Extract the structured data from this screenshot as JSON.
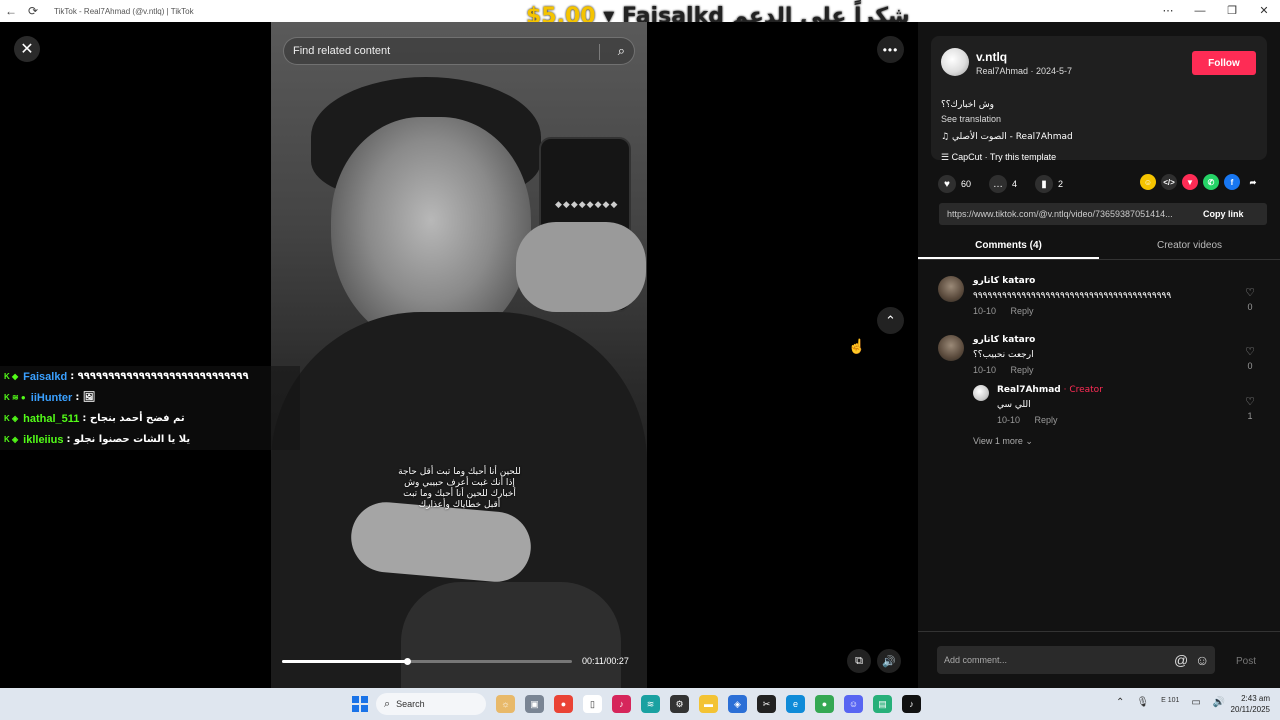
{
  "browser": {
    "title": "TikTok - Real7Ahmad (@v.ntlq) | TikTok",
    "back_icon": "←",
    "reload_icon": "⟳",
    "menu_icon": "⋯",
    "minimize_icon": "—",
    "restore_icon": "❐",
    "close_icon": "✕"
  },
  "donation": {
    "amount": "$5.00",
    "name": "Faisalkd",
    "rest": "شكراً على الدعم"
  },
  "player": {
    "close_label": "✕",
    "search_placeholder": "Find related content",
    "more_label": "•••",
    "up_label": "⌃",
    "caption": "للحين أنا أحبك وما تبت أقل حاجة إذا أنك غبت أعرف حبيبي وش أخبارك للحين أنا أحبك وما تبت أقبل خطاياك وأعذارك",
    "progress": 0.43,
    "time": "00:11/00:27",
    "phone_dots": "◆◆◆◆◆◆◆◆"
  },
  "chat": [
    {
      "badges": "K ◆",
      "name": "Faisalkd",
      "color": "#3aa0ff",
      "text": "٩٩٩٩٩٩٩٩٩٩٩٩٩٩٩٩٩٩٩٩٩٩٩٩٩٩٩٩"
    },
    {
      "badges": "K ≋ ●",
      "name": "iiHunter",
      "color": "#3aa0ff",
      "text": "🖼"
    },
    {
      "badges": "K ◈",
      "name": "hathal_511",
      "color": "#53fc18",
      "text": "تم فضح أحمد بنجاح"
    },
    {
      "badges": "K ◈",
      "name": "iklleiius",
      "color": "#53fc18",
      "text": "يلا يا الشات حصنوا نجلو"
    }
  ],
  "author": {
    "username": "v.ntlq",
    "display_name": "Real7Ahmad",
    "date": "2024-5-7",
    "follow_label": "Follow",
    "description": "وش اخبارك؟؟",
    "see_translation": "See translation",
    "music": "♫  الصوت الأصلي - Real7Ahmad",
    "capcut": "☰  CapCut · Try this template"
  },
  "stats": {
    "likes": "60",
    "comments": "4",
    "saves": "2",
    "like_icon": "♥",
    "comment_icon": "…",
    "save_icon": "▮"
  },
  "share_icons": [
    "☺",
    "</>",
    "▼",
    "✆",
    "f",
    "➦"
  ],
  "link": {
    "url": "https://www.tiktok.com/@v.ntlq/video/73659387051414...",
    "copy_label": "Copy link"
  },
  "tabs": [
    "Comments (4)",
    "Creator videos"
  ],
  "comments": [
    {
      "name": "كاتارو kataro",
      "text": "٩٩٩٩٩٩٩٩٩٩٩٩٩٩٩٩٩٩٩٩٩٩٩٩٩٩٩٩٩٩٩٩٩٩٩٩٩٩٩٩٩",
      "date": "10-10",
      "reply": "Reply",
      "likes": "0"
    },
    {
      "name": "كاتارو kataro",
      "text": "ارجعت نحبيب؟؟",
      "date": "10-10",
      "reply": "Reply",
      "likes": "0"
    }
  ],
  "reply_comment": {
    "name": "Real7Ahmad",
    "badge": " · Creator",
    "text": "اللي سي",
    "date": "10-10",
    "reply": "Reply",
    "likes": "1"
  },
  "view_more": "View 1 more ⌄",
  "add_comment": {
    "placeholder": "Add comment...",
    "at_icon": "@",
    "emoji_icon": "☺",
    "post_label": "Post"
  },
  "taskbar": {
    "search_label": "Search",
    "search_icon": "⌕",
    "tray": [
      "⌃",
      "🎙",
      "E 101",
      "▭",
      "🔊"
    ],
    "time": "2:43 am",
    "date": "20/11/2025"
  },
  "colors": {
    "accent": "#fe2c55",
    "chat_green": "#53fc18",
    "chat_blue": "#3aa0ff",
    "donation": "#f5c400"
  }
}
